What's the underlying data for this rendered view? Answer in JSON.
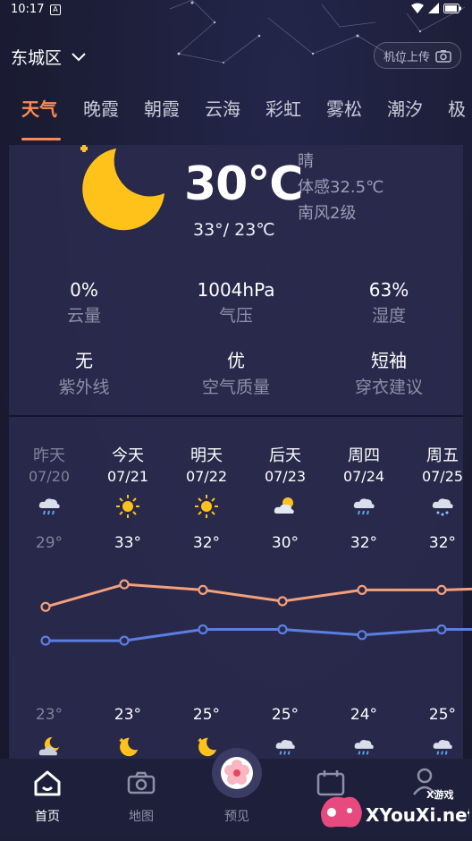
{
  "status_bar": {
    "time": "10:17",
    "nfc": "A"
  },
  "header": {
    "location": "东城区",
    "upload_label": "机位上传"
  },
  "tabs": [
    "天气",
    "晚霞",
    "朝霞",
    "云海",
    "彩虹",
    "雾松",
    "潮汐",
    "极"
  ],
  "current": {
    "temperature": "30℃",
    "condition": "晴",
    "feels_like": "体感32.5℃",
    "wind": "南风2级",
    "high_low": "33°/ 23℃"
  },
  "stats": [
    {
      "value": "0%",
      "label": "云量"
    },
    {
      "value": "1004hPa",
      "label": "气压"
    },
    {
      "value": "63%",
      "label": "湿度"
    },
    {
      "value": "无",
      "label": "紫外线"
    },
    {
      "value": "优",
      "label": "空气质量"
    },
    {
      "value": "短袖",
      "label": "穿衣建议"
    }
  ],
  "forecast": [
    {
      "name": "昨天",
      "date": "07/20",
      "high": "29°",
      "low": "23°",
      "day_icon": "rain-cloud-icon",
      "night_icon": "cloudy-moon-icon",
      "past": true
    },
    {
      "name": "今天",
      "date": "07/21",
      "high": "33°",
      "low": "23°",
      "day_icon": "sun-icon",
      "night_icon": "moon-icon",
      "past": false
    },
    {
      "name": "明天",
      "date": "07/22",
      "high": "32°",
      "low": "25°",
      "day_icon": "sun-icon",
      "night_icon": "moon-icon",
      "past": false
    },
    {
      "name": "后天",
      "date": "07/23",
      "high": "30°",
      "low": "25°",
      "day_icon": "partly-cloudy-icon",
      "night_icon": "rain-cloud-icon",
      "past": false
    },
    {
      "name": "周四",
      "date": "07/24",
      "high": "32°",
      "low": "24°",
      "day_icon": "rain-cloud-icon",
      "night_icon": "rain-cloud-icon",
      "past": false
    },
    {
      "name": "周五",
      "date": "07/25",
      "high": "32°",
      "low": "25°",
      "day_icon": "snow-rain-icon",
      "night_icon": "rain-cloud-icon",
      "past": false
    }
  ],
  "chart_data": {
    "type": "line",
    "categories": [
      "07/20",
      "07/21",
      "07/22",
      "07/23",
      "07/24",
      "07/25"
    ],
    "series": [
      {
        "values": [
          29,
          33,
          32,
          30,
          32,
          32
        ]
      },
      {
        "values": [
          23,
          23,
          25,
          25,
          24,
          25
        ]
      }
    ],
    "colors": {
      "high": "#f4a07a",
      "low": "#5b7fe0"
    }
  },
  "bottom_nav": [
    {
      "label": "首页",
      "icon": "home-icon",
      "active": true
    },
    {
      "label": "地图",
      "icon": "camera-icon",
      "active": false
    },
    {
      "label": "预见",
      "icon": "flower-icon",
      "active": false
    },
    {
      "label": "",
      "icon": "calendar-icon",
      "active": false
    },
    {
      "label": "",
      "icon": "user-icon",
      "active": false
    }
  ],
  "watermark": {
    "top": "X游戏",
    "bottom": "XYouXi.net"
  },
  "colors": {
    "accent": "#ff8a4f",
    "panel": "#29294c",
    "background": "#1c1d36"
  }
}
